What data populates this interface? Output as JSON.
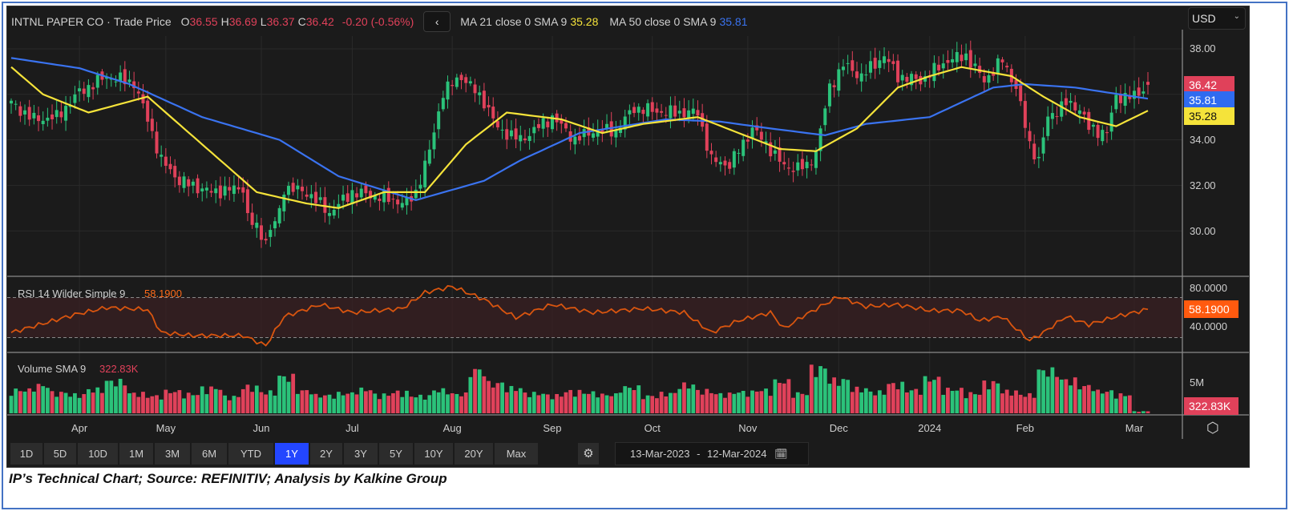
{
  "header": {
    "name": "INTNL PAPER CO",
    "sep": "·",
    "type": "Trade Price",
    "o_label": "O",
    "o": "36.55",
    "h_label": "H",
    "h": "36.69",
    "l_label": "L",
    "l": "36.37",
    "c_label": "C",
    "c": "36.42",
    "change": "-0.20 (-0.56%)",
    "back": "‹",
    "ma21_label": "MA 21 close 0 SMA 9",
    "ma21": "35.28",
    "ma50_label": "MA 50 close 0 SMA 9",
    "ma50": "35.81"
  },
  "currency": "USD",
  "rsi_label": "RSI 14 Wilder Simple 9",
  "rsi_value": "58.1900",
  "volume_label": "Volume SMA 9",
  "volume_value": "322.83K",
  "price_ticks": [
    "38.00",
    "34.00",
    "32.00",
    "30.00"
  ],
  "rsi_ticks": [
    "80.0000",
    "40.0000"
  ],
  "volume_tick": "5M",
  "tags": {
    "close": "36.42",
    "ma50": "35.81",
    "ma21": "35.28",
    "rsi": "58.1900",
    "volume": "322.83K"
  },
  "colors": {
    "up": "#2bc27a",
    "down": "#e0415a",
    "ma21": "#f5e33a",
    "ma50": "#3a73f0",
    "rsi": "#d9550f",
    "accent": "#2346ff"
  },
  "periods": [
    "1D",
    "5D",
    "10D",
    "1M",
    "3M",
    "6M",
    "YTD",
    "1Y",
    "2Y",
    "3Y",
    "5Y",
    "10Y",
    "20Y",
    "Max"
  ],
  "active_period": "1Y",
  "date_range": {
    "from": "13-Mar-2023",
    "sep": "-",
    "to": "12-Mar-2024"
  },
  "caption": "IP’s Technical Chart; Source: REFINITIV; Analysis by Kalkine Group",
  "chart_data": {
    "type": "candlestick",
    "title": "INTNL PAPER CO · Trade Price",
    "ylim": [
      28.3,
      38.6
    ],
    "rsi_ylim": [
      18,
      88
    ],
    "rsi_bands": [
      30,
      70
    ],
    "days": 250,
    "months": [
      {
        "label": "Apr",
        "day": 15
      },
      {
        "label": "May",
        "day": 34
      },
      {
        "label": "Jun",
        "day": 55
      },
      {
        "label": "Jul",
        "day": 75
      },
      {
        "label": "Aug",
        "day": 97
      },
      {
        "label": "Sep",
        "day": 119
      },
      {
        "label": "Oct",
        "day": 141
      },
      {
        "label": "Nov",
        "day": 162
      },
      {
        "label": "Dec",
        "day": 182
      },
      {
        "label": "2024",
        "day": 202
      },
      {
        "label": "Feb",
        "day": 223
      },
      {
        "label": "Mar",
        "day": 247
      }
    ],
    "close_anchors": [
      [
        0,
        35.6
      ],
      [
        5,
        34.9
      ],
      [
        10,
        35.0
      ],
      [
        15,
        36.1
      ],
      [
        21,
        36.8
      ],
      [
        27,
        36.5
      ],
      [
        30,
        34.9
      ],
      [
        33,
        33.1
      ],
      [
        37,
        32.2
      ],
      [
        44,
        31.7
      ],
      [
        51,
        31.9
      ],
      [
        52,
        30.6
      ],
      [
        56,
        29.6
      ],
      [
        59,
        30.8
      ],
      [
        60,
        31.9
      ],
      [
        65,
        31.7
      ],
      [
        70,
        30.8
      ],
      [
        75,
        31.7
      ],
      [
        81,
        31.5
      ],
      [
        87,
        31.2
      ],
      [
        89,
        31.7
      ],
      [
        92,
        33.5
      ],
      [
        95,
        36.1
      ],
      [
        99,
        36.8
      ],
      [
        104,
        35.7
      ],
      [
        107,
        34.5
      ],
      [
        112,
        34.0
      ],
      [
        119,
        35.0
      ],
      [
        124,
        34.0
      ],
      [
        128,
        34.4
      ],
      [
        133,
        34.4
      ],
      [
        137,
        35.4
      ],
      [
        144,
        35.2
      ],
      [
        151,
        35.2
      ],
      [
        154,
        33.1
      ],
      [
        158,
        32.9
      ],
      [
        163,
        34.5
      ],
      [
        167,
        33.6
      ],
      [
        170,
        32.8
      ],
      [
        175,
        32.8
      ],
      [
        177,
        33.5
      ],
      [
        180,
        36.3
      ],
      [
        183,
        37.3
      ],
      [
        187,
        36.8
      ],
      [
        192,
        37.7
      ],
      [
        195,
        36.8
      ],
      [
        200,
        36.6
      ],
      [
        206,
        37.5
      ],
      [
        210,
        37.7
      ],
      [
        214,
        36.6
      ],
      [
        218,
        37.5
      ],
      [
        221,
        36.3
      ],
      [
        224,
        33.8
      ],
      [
        226,
        33.1
      ],
      [
        228,
        35.0
      ],
      [
        232,
        35.6
      ],
      [
        235,
        35.4
      ],
      [
        237,
        34.5
      ],
      [
        241,
        34.3
      ],
      [
        243,
        35.9
      ],
      [
        247,
        35.9
      ],
      [
        250,
        36.42
      ]
    ],
    "ma50_anchors": [
      [
        0,
        37.6
      ],
      [
        15,
        37.15
      ],
      [
        26,
        36.45
      ],
      [
        42,
        35.0
      ],
      [
        59,
        34.0
      ],
      [
        72,
        32.4
      ],
      [
        89,
        31.35
      ],
      [
        104,
        32.2
      ],
      [
        112,
        33.1
      ],
      [
        125,
        34.3
      ],
      [
        144,
        34.9
      ],
      [
        156,
        34.8
      ],
      [
        167,
        34.5
      ],
      [
        179,
        34.2
      ],
      [
        188,
        34.7
      ],
      [
        202,
        35.0
      ],
      [
        216,
        36.3
      ],
      [
        223,
        36.45
      ],
      [
        234,
        36.3
      ],
      [
        250,
        35.81
      ]
    ],
    "ma21_anchors": [
      [
        0,
        37.2
      ],
      [
        7,
        36.0
      ],
      [
        17,
        35.2
      ],
      [
        30,
        35.9
      ],
      [
        42,
        33.8
      ],
      [
        54,
        31.7
      ],
      [
        65,
        31.2
      ],
      [
        72,
        31.0
      ],
      [
        82,
        31.7
      ],
      [
        91,
        31.7
      ],
      [
        100,
        33.8
      ],
      [
        109,
        35.2
      ],
      [
        121,
        34.9
      ],
      [
        130,
        34.3
      ],
      [
        139,
        34.7
      ],
      [
        151,
        35.0
      ],
      [
        160,
        34.3
      ],
      [
        169,
        33.6
      ],
      [
        177,
        33.5
      ],
      [
        186,
        34.5
      ],
      [
        195,
        36.3
      ],
      [
        202,
        36.8
      ],
      [
        209,
        37.2
      ],
      [
        220,
        36.8
      ],
      [
        227,
        35.9
      ],
      [
        235,
        35.0
      ],
      [
        243,
        34.6
      ],
      [
        250,
        35.28
      ]
    ],
    "rsi_anchors": [
      [
        0,
        35
      ],
      [
        14,
        53
      ],
      [
        21,
        60
      ],
      [
        30,
        58
      ],
      [
        33,
        35
      ],
      [
        40,
        32
      ],
      [
        51,
        32
      ],
      [
        56,
        22
      ],
      [
        60,
        51
      ],
      [
        68,
        63
      ],
      [
        75,
        55
      ],
      [
        86,
        59
      ],
      [
        91,
        75
      ],
      [
        97,
        81
      ],
      [
        104,
        68
      ],
      [
        111,
        50
      ],
      [
        119,
        63
      ],
      [
        128,
        55
      ],
      [
        139,
        59
      ],
      [
        148,
        55
      ],
      [
        154,
        35
      ],
      [
        160,
        47
      ],
      [
        167,
        55
      ],
      [
        170,
        39
      ],
      [
        174,
        51
      ],
      [
        182,
        71
      ],
      [
        188,
        61
      ],
      [
        195,
        63
      ],
      [
        202,
        57
      ],
      [
        209,
        57
      ],
      [
        213,
        47
      ],
      [
        218,
        51
      ],
      [
        224,
        27
      ],
      [
        227,
        35
      ],
      [
        232,
        51
      ],
      [
        237,
        43
      ],
      [
        243,
        51
      ],
      [
        250,
        58.19
      ]
    ],
    "volume_millions": [
      3.5,
      4.2,
      3.1,
      2.8,
      3.6,
      4.8,
      3.0,
      2.6,
      3.3,
      2.9,
      3.8,
      2.5,
      4.0,
      3.2,
      5.5,
      3.4,
      2.7,
      3.0,
      3.6,
      2.8,
      3.2,
      2.6,
      3.5,
      2.9,
      6.5,
      4.5,
      3.8,
      3.0,
      2.7,
      3.3,
      3.1,
      2.8,
      3.9,
      2.6,
      3.0,
      4.3,
      3.4,
      2.9,
      3.2,
      3.5,
      4.8,
      3.0,
      6.8,
      5.0,
      3.7,
      3.2,
      4.4,
      3.5,
      5.2,
      3.6,
      3.0,
      4.6,
      3.3,
      2.8,
      6.4,
      5.0,
      4.1,
      3.3,
      2.8,
      0.3
    ]
  }
}
